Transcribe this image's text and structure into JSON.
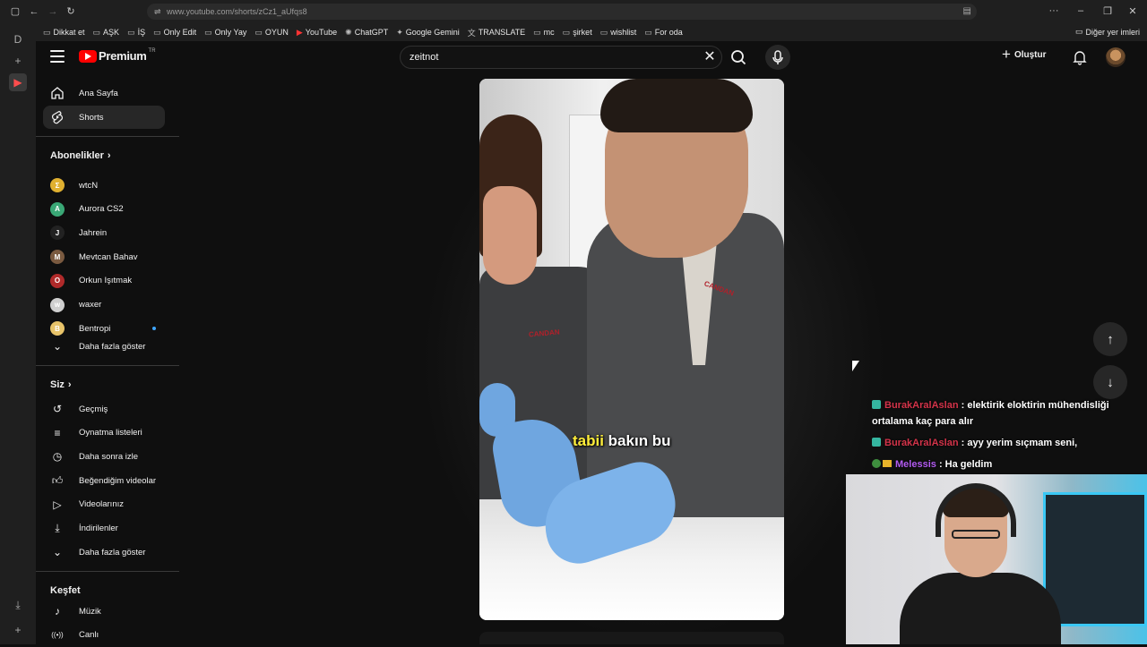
{
  "browser": {
    "url": "www.youtube.com/shorts/zCz1_aUfqs8",
    "bookmarks": [
      {
        "label": "Dikkat et",
        "icon": "folder-icon"
      },
      {
        "label": "AŞK",
        "icon": "folder-icon"
      },
      {
        "label": "İŞ",
        "icon": "folder-icon"
      },
      {
        "label": "Only Edit",
        "icon": "folder-icon"
      },
      {
        "label": "Only Yay",
        "icon": "folder-icon"
      },
      {
        "label": "OYUN",
        "icon": "folder-icon"
      },
      {
        "label": "YouTube",
        "icon": "youtube-icon"
      },
      {
        "label": "ChatGPT",
        "icon": "chatgpt-icon"
      },
      {
        "label": "Google Gemini",
        "icon": "gemini-icon"
      },
      {
        "label": "TRANSLATE",
        "icon": "translate-icon"
      },
      {
        "label": "mc",
        "icon": "folder-icon"
      },
      {
        "label": "şirket",
        "icon": "folder-icon"
      },
      {
        "label": "wishlist",
        "icon": "folder-icon"
      },
      {
        "label": "For oda",
        "icon": "folder-icon"
      }
    ],
    "other_bookmarks": "Diğer yer imleri"
  },
  "masthead": {
    "logo_text": "Premium",
    "region": "TR",
    "search_value": "zeitnot",
    "create_label": "Oluştur"
  },
  "sidebar": {
    "home": "Ana Sayfa",
    "shorts": "Shorts",
    "subscriptions_title": "Abonelikler",
    "channels": [
      {
        "name": "wtcN",
        "color": "#e0b030",
        "initial": "Σ"
      },
      {
        "name": "Aurora CS2",
        "color": "#3aa876",
        "initial": "A"
      },
      {
        "name": "Jahrein",
        "color": "#222222",
        "initial": "J"
      },
      {
        "name": "Mevtcan Bahav",
        "color": "#7a5a40",
        "initial": "M"
      },
      {
        "name": "Orkun Işıtmak",
        "color": "#b02a2a",
        "initial": "O"
      },
      {
        "name": "waxer",
        "color": "#cfcfcf",
        "initial": "w"
      },
      {
        "name": "Bentropi",
        "color": "#e8c46a",
        "initial": "B"
      }
    ],
    "show_more_1": "Daha fazla göster",
    "you_title": "Siz",
    "you_items": [
      {
        "label": "Geçmiş",
        "icon": "history-icon"
      },
      {
        "label": "Oynatma listeleri",
        "icon": "playlists-icon"
      },
      {
        "label": "Daha sonra izle",
        "icon": "watch-later-icon"
      },
      {
        "label": "Beğendiğim videolar",
        "icon": "thumbs-up-icon"
      },
      {
        "label": "Videolarınız",
        "icon": "your-videos-icon"
      },
      {
        "label": "İndirilenler",
        "icon": "download-icon"
      }
    ],
    "show_more_2": "Daha fazla göster",
    "explore_title": "Keşfet",
    "explore_items": [
      {
        "label": "Müzik",
        "icon": "music-icon"
      },
      {
        "label": "Canlı",
        "icon": "live-icon"
      }
    ]
  },
  "short": {
    "caption_highlight": "tabii",
    "caption_rest": " bakın bu",
    "jacket_logo": "CANDAN"
  },
  "chat": [
    {
      "user": "BurakAralAslan",
      "message": ": elektirik eloktirin mühendisliği ortalama kaç para alır"
    },
    {
      "user": "BurakAralAslan",
      "message": ": ayy yerim sıçmam seni,"
    },
    {
      "user": "Melessis",
      "message": ": Ha geldim"
    }
  ],
  "colors": {
    "accent": "#ff0000",
    "background": "#0f0f0f",
    "chat_user_1": "#d4344a",
    "chat_user_2": "#b35cf2",
    "caption_highlight": "#ffee3a"
  }
}
